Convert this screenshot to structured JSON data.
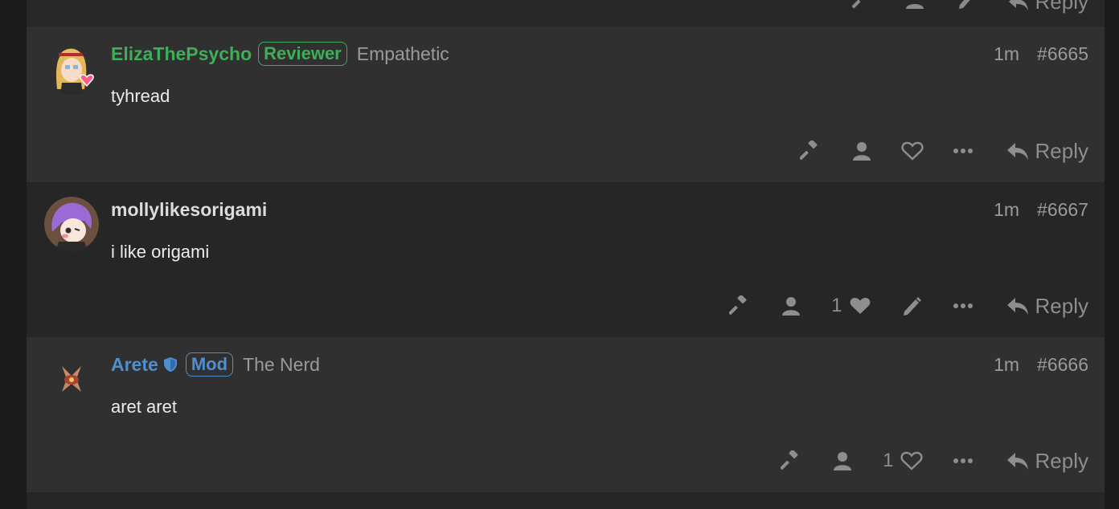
{
  "top_strip": {
    "reply_label": "Reply"
  },
  "posts": [
    {
      "username": "ElizaThePsycho",
      "username_color": "#3fae58",
      "badge": "Reviewer",
      "badge_color": "#3fae58",
      "title": "Empathetic",
      "time": "1m",
      "number": "#6665",
      "body": "tyhread",
      "like_count": "",
      "reply_label": "Reply"
    },
    {
      "username": "mollylikesorigami",
      "username_color": "#dcdcdc",
      "badge": "",
      "title": "",
      "time": "1m",
      "number": "#6667",
      "body": "i like origami",
      "like_count": "1",
      "reply_label": "Reply"
    },
    {
      "username": "Arete",
      "username_color": "#4f8fd0",
      "badge": "Mod",
      "badge_color": "#4f8fd0",
      "title": "The Nerd",
      "time": "1m",
      "number": "#6666",
      "body": "aret aret",
      "like_count": "1",
      "reply_label": "Reply"
    }
  ],
  "icons": [
    "gavel-icon",
    "user-icon",
    "heart-icon",
    "heart-filled-icon",
    "pencil-icon",
    "more-icon",
    "reply-icon",
    "shield-icon"
  ]
}
